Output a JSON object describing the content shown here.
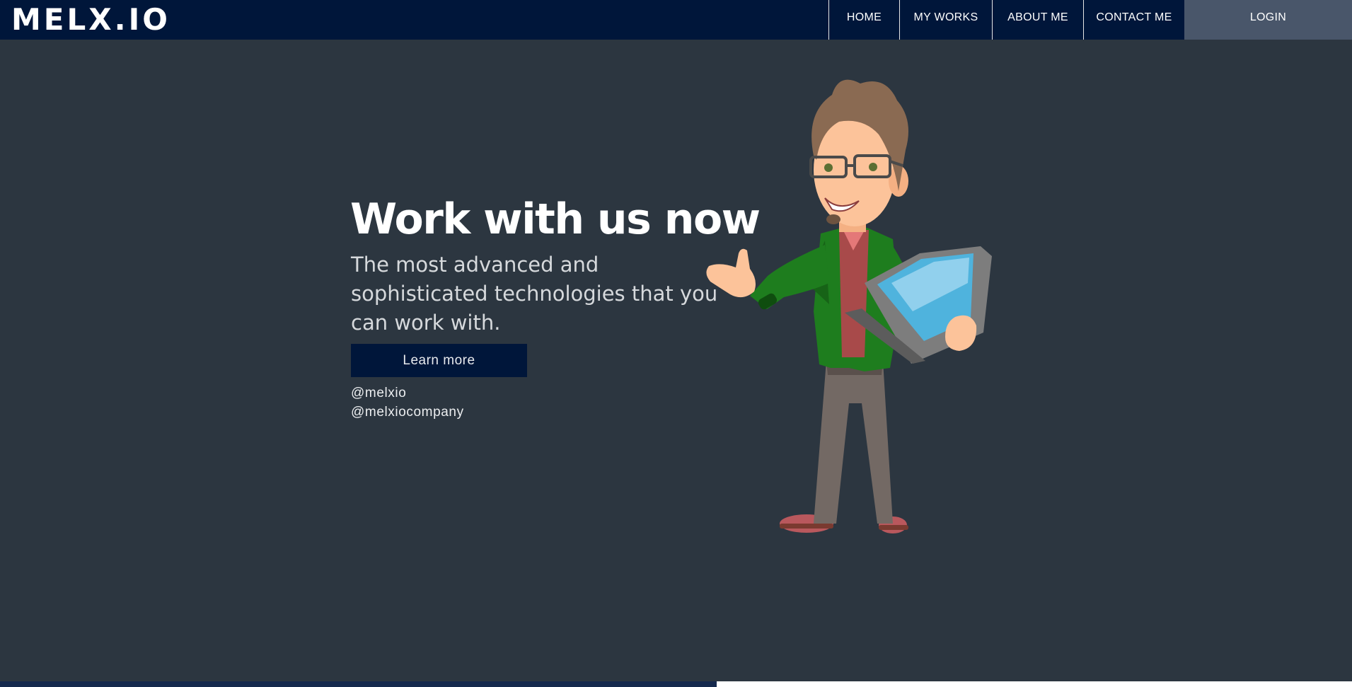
{
  "header": {
    "logo": "MELX.IO",
    "nav": [
      "HOME",
      "MY WORKS",
      "ABOUT ME",
      "CONTACT ME"
    ],
    "login": "LOGIN"
  },
  "hero": {
    "title": "Work with us now",
    "subtitle": "The most advanced and sophisticated technologies that you can work with.",
    "cta": "Learn more",
    "social": [
      "@melxio",
      "@melxiocompany"
    ],
    "illustration_icon": "developer-mascot-with-laptop-icon"
  },
  "scroll_progress": {
    "fraction": 0.53
  },
  "colors": {
    "header_bg": "#00163a",
    "page_bg": "#2c3640",
    "login_bg": "#49566a",
    "button_bg": "#00163a"
  }
}
